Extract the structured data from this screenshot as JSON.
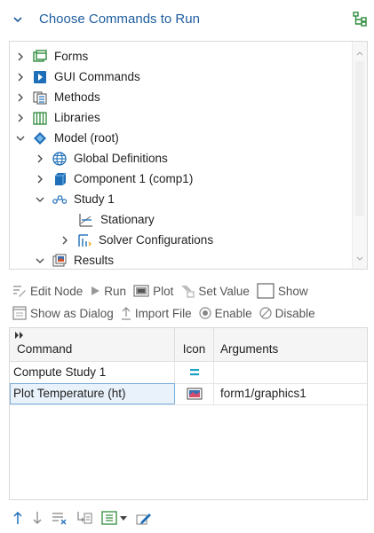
{
  "header": {
    "title": "Choose Commands to Run"
  },
  "tree": {
    "items": [
      {
        "label": "Forms",
        "icon": "forms-icon"
      },
      {
        "label": "GUI Commands",
        "icon": "gui-commands-icon"
      },
      {
        "label": "Methods",
        "icon": "methods-icon"
      },
      {
        "label": "Libraries",
        "icon": "libraries-icon"
      },
      {
        "label": "Model (root)",
        "icon": "model-root-icon"
      },
      {
        "label": "Global Definitions",
        "icon": "globe-icon"
      },
      {
        "label": "Component 1 (comp1)",
        "icon": "component-icon"
      },
      {
        "label": "Study 1",
        "icon": "study-icon"
      },
      {
        "label": "Stationary",
        "icon": "stationary-icon"
      },
      {
        "label": "Solver Configurations",
        "icon": "solver-configurations-icon"
      },
      {
        "label": "Results",
        "icon": "results-icon"
      }
    ]
  },
  "toolbar": {
    "edit_node": "Edit Node",
    "run": "Run",
    "plot": "Plot",
    "set_value": "Set Value",
    "show": "Show",
    "show_as_dialog": "Show as Dialog",
    "import_file": "Import File",
    "enable": "Enable",
    "disable": "Disable"
  },
  "table": {
    "headers": {
      "command": "Command",
      "icon": "Icon",
      "arguments": "Arguments"
    },
    "rows": [
      {
        "command": "Compute Study 1",
        "icon": "compute-equals-icon",
        "arguments": ""
      },
      {
        "command": "Plot Temperature (ht)",
        "icon": "plot-icon",
        "arguments": "form1/graphics1"
      }
    ]
  },
  "colors": {
    "accent": "#1e5d9e",
    "selection_border": "#7fb1e0",
    "selection_fill": "#e9f2fb"
  }
}
